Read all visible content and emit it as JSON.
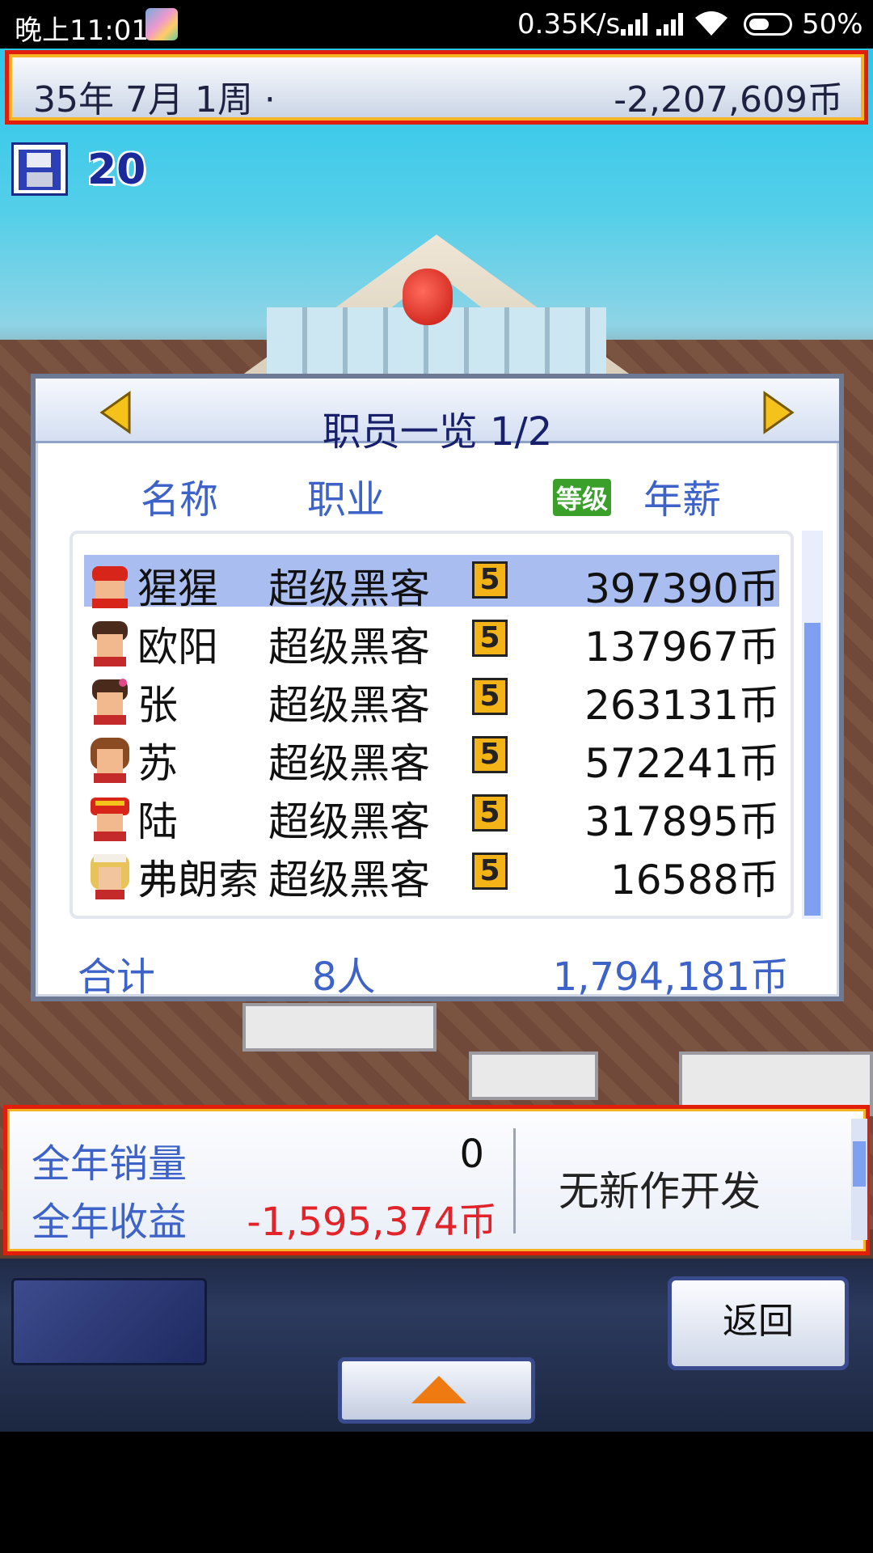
{
  "status_bar": {
    "time": "晚上11:01",
    "network_speed": "0.35K/s",
    "battery": "50%"
  },
  "header": {
    "date": "35年 7月 1周 ·",
    "money": "-2,207,609币"
  },
  "save": {
    "count": "20"
  },
  "dialog": {
    "title": "职员一览 1/2",
    "columns": {
      "name": "名称",
      "job": "职业",
      "level": "等级",
      "salary": "年薪"
    },
    "rows": [
      {
        "name": "猩猩",
        "job": "超级黑客",
        "level": "5",
        "salary": "397390币"
      },
      {
        "name": "欧阳",
        "job": "超级黑客",
        "level": "5",
        "salary": "137967币"
      },
      {
        "name": "张",
        "job": "超级黑客",
        "level": "5",
        "salary": "263131币"
      },
      {
        "name": "苏",
        "job": "超级黑客",
        "level": "5",
        "salary": "572241币"
      },
      {
        "name": "陆",
        "job": "超级黑客",
        "level": "5",
        "salary": "317895币"
      },
      {
        "name": "弗朗索",
        "job": "超级黑客",
        "level": "5",
        "salary": "16588币"
      }
    ],
    "total_label": "合计",
    "total_people": "8人",
    "total_salary": "1,794,181币"
  },
  "info": {
    "sales_label": "全年销量",
    "sales_value": "0",
    "profit_label": "全年收益",
    "profit_value": "-1,595,374币",
    "dev_status": "无新作开发"
  },
  "buttons": {
    "back": "返回"
  },
  "colors": {
    "frame_red": "#e11d0c",
    "frame_gold": "#f6b324",
    "label_blue": "#3d62c8",
    "negative_red": "#e3232a",
    "selected_row": "#a9bdf0",
    "level_badge": "#f4b316"
  }
}
